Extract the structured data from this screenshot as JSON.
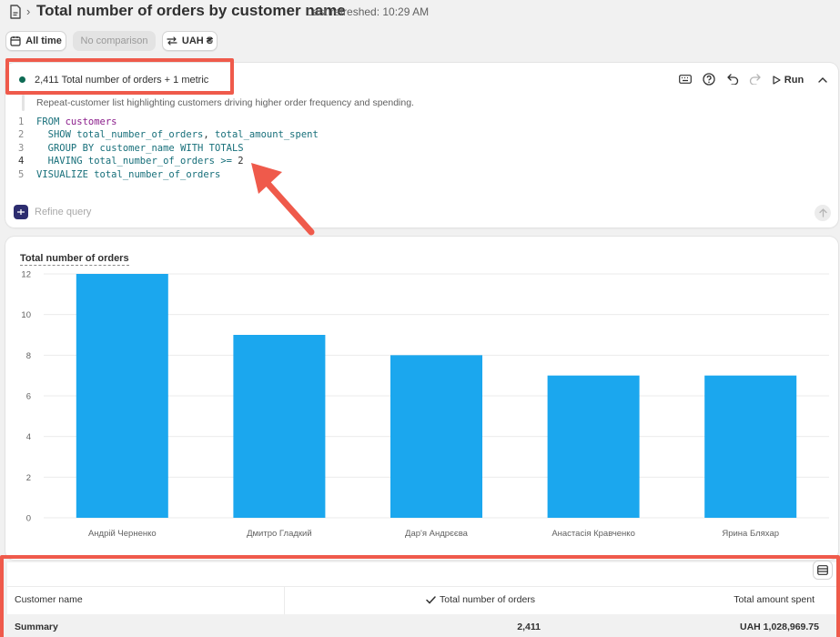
{
  "header": {
    "title": "Total number of orders by customer name",
    "separator": "›",
    "last_refreshed": "Last refreshed: 10:29 AM"
  },
  "filters": {
    "date_range": "All time",
    "comparison": "No comparison",
    "currency": "UAH ₴"
  },
  "editor": {
    "metric_summary": "2,411 Total number of orders + 1 metric",
    "run_label": "Run",
    "description": "Repeat-customer list highlighting customers driving higher order frequency and spending.",
    "code_lines": [
      {
        "n": "1",
        "parts": [
          [
            "kw",
            "FROM "
          ],
          [
            "tb",
            "customers"
          ]
        ]
      },
      {
        "n": "2",
        "parts": [
          [
            "kw",
            "  SHOW "
          ],
          [
            "id",
            "total_number_of_orders"
          ],
          [
            "num",
            ", "
          ],
          [
            "id",
            "total_amount_spent"
          ]
        ]
      },
      {
        "n": "3",
        "parts": [
          [
            "kw",
            "  GROUP BY "
          ],
          [
            "id",
            "customer_name "
          ],
          [
            "kw",
            "WITH TOTALS"
          ]
        ]
      },
      {
        "n": "4",
        "parts": [
          [
            "kw",
            "  HAVING "
          ],
          [
            "id",
            "total_number_of_orders "
          ],
          [
            "kw",
            ">= "
          ],
          [
            "num",
            "2"
          ]
        ]
      },
      {
        "n": "5",
        "parts": [
          [
            "kw",
            "VISUALIZE "
          ],
          [
            "id",
            "total_number_of_orders"
          ]
        ]
      }
    ],
    "refine_placeholder": "Refine query"
  },
  "colors": {
    "bar": "#1ba7ee",
    "highlight": "#ef5a4b",
    "status_dot": "#0e6b54"
  },
  "chart_data": {
    "type": "bar",
    "title": "Total number of orders",
    "categories": [
      "Андрій Черненко",
      "Дмитро Гладкий",
      "Дар'я Андрєєва",
      "Анастасія Кравченко",
      "Ярина Бляхар"
    ],
    "values": [
      12,
      9,
      8,
      7,
      7
    ],
    "ylim": [
      0,
      12
    ],
    "yticks": [
      0,
      2,
      4,
      6,
      8,
      10,
      12
    ],
    "grid": true
  },
  "table": {
    "columns": [
      "Customer name",
      "Total number of orders",
      "Total amount spent"
    ],
    "summary": {
      "label": "Summary",
      "orders": "2,411",
      "amount": "UAH 1,028,969.75"
    }
  }
}
